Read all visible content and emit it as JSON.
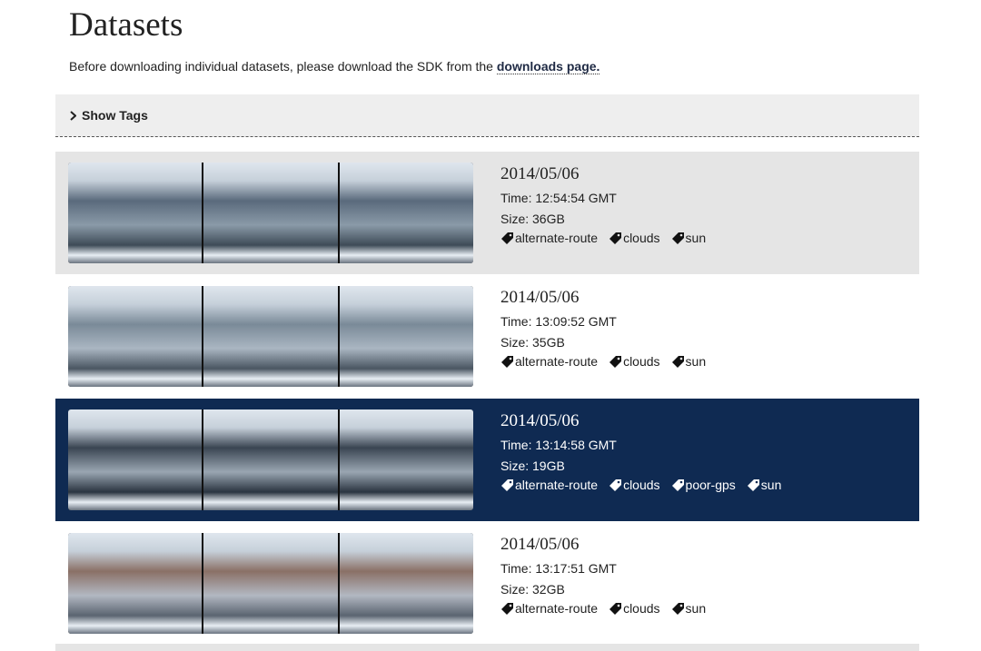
{
  "page_title": "Datasets",
  "intro": {
    "text": "Before downloading individual datasets, please download the SDK from the ",
    "link_label": "downloads page."
  },
  "tags_toggle": {
    "label": "Show Tags",
    "icon": "chevron-right-icon"
  },
  "datasets": [
    {
      "date": "2014/05/06",
      "time": "Time: 12:54:54 GMT",
      "size": "Size: 36GB",
      "tags": [
        "alternate-route",
        "clouds",
        "sun"
      ],
      "style": "gray"
    },
    {
      "date": "2014/05/06",
      "time": "Time: 13:09:52 GMT",
      "size": "Size: 35GB",
      "tags": [
        "alternate-route",
        "clouds",
        "sun"
      ],
      "style": "white"
    },
    {
      "date": "2014/05/06",
      "time": "Time: 13:14:58 GMT",
      "size": "Size: 19GB",
      "tags": [
        "alternate-route",
        "clouds",
        "poor-gps",
        "sun"
      ],
      "style": "selected"
    },
    {
      "date": "2014/05/06",
      "time": "Time: 13:17:51 GMT",
      "size": "Size: 32GB",
      "tags": [
        "alternate-route",
        "clouds",
        "sun"
      ],
      "style": "white"
    }
  ],
  "colors": {
    "selected_row": "#0f2a52",
    "gray_row": "#e5e5e5",
    "tag_bar": "#eeeeee"
  }
}
